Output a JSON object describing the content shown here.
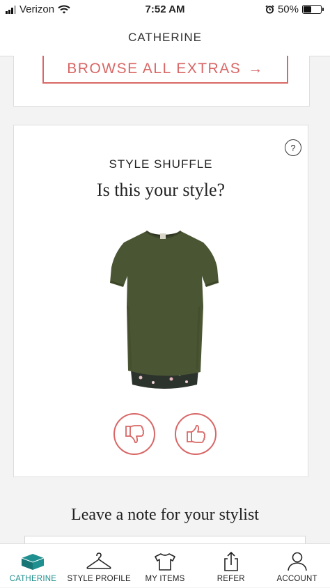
{
  "status": {
    "carrier": "Verizon",
    "time": "7:52 AM",
    "battery": "50%",
    "battery_level": 0.5
  },
  "header": {
    "title": "CATHERINE"
  },
  "extras": {
    "browse_label": "BROWSE ALL EXTRAS",
    "arrow": "→"
  },
  "shuffle": {
    "help_label": "?",
    "title": "STYLE SHUFFLE",
    "question": "Is this your style?",
    "item_image": "olive-green-short-sleeve-top-with-floral-back"
  },
  "note": {
    "heading": "Leave a note for your stylist"
  },
  "tabs": [
    {
      "label": "CATHERINE",
      "icon": "box-icon",
      "active": true
    },
    {
      "label": "STYLE PROFILE",
      "icon": "hanger-icon",
      "active": false
    },
    {
      "label": "MY ITEMS",
      "icon": "shirt-icon",
      "active": false
    },
    {
      "label": "REFER",
      "icon": "share-icon",
      "active": false
    },
    {
      "label": "ACCOUNT",
      "icon": "person-icon",
      "active": false
    }
  ],
  "colors": {
    "accent": "#d86766",
    "active_tab": "#1f8f8f",
    "background": "#f3f3f3"
  }
}
